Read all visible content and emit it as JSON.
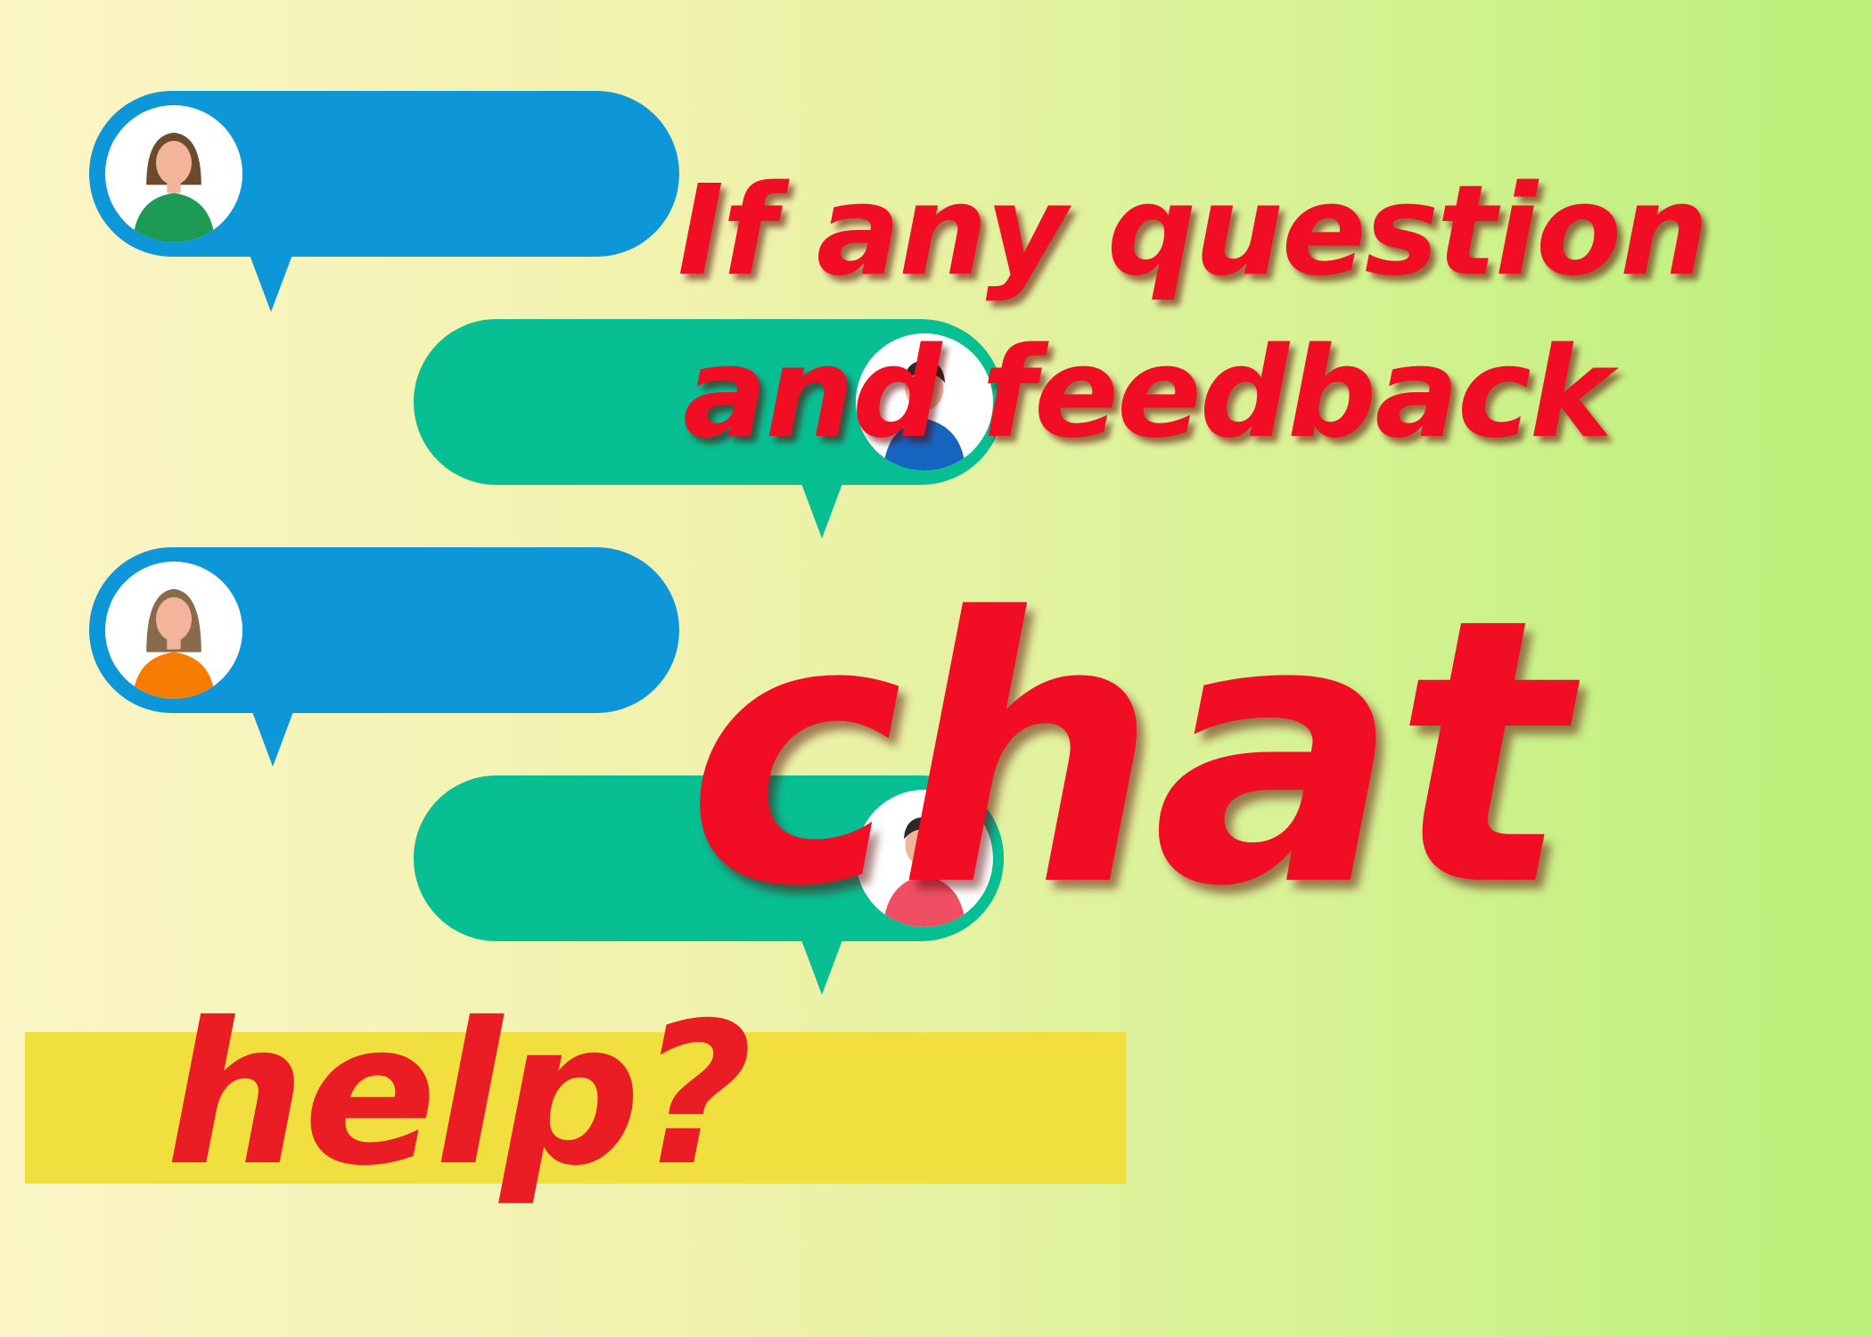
{
  "heading": {
    "line1": "If any question",
    "line2": "and feedback",
    "word": "chat"
  },
  "help": {
    "label": "help?"
  },
  "colors": {
    "headline_red": "#f10d24",
    "help_red": "#ea1c24",
    "help_band_yellow": "#f1de3f",
    "bubble_blue": "#0d96d8",
    "bubble_teal": "#08be93",
    "background_left": "#fbf5c6",
    "background_right": "#b9f07a"
  },
  "icons": [
    "woman-avatar-icon",
    "man-avatar-icon",
    "woman-avatar-icon",
    "man-avatar-icon",
    "speech-bubble-icon"
  ]
}
